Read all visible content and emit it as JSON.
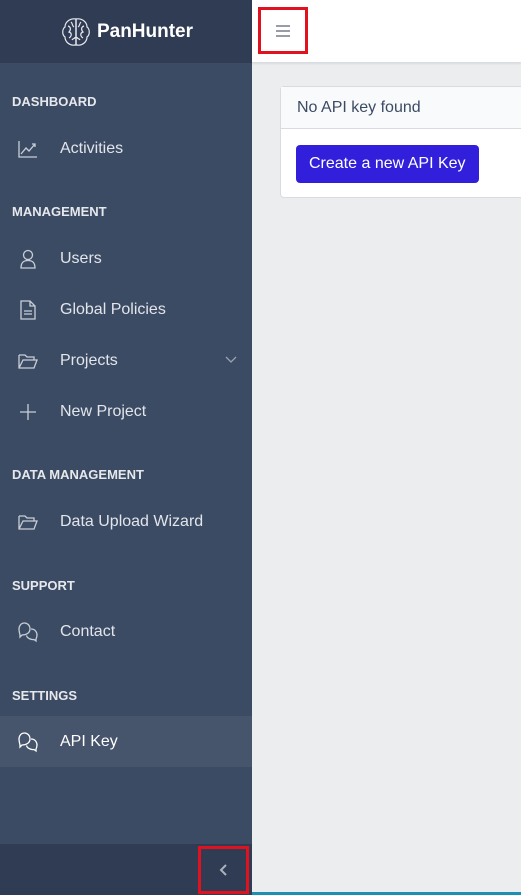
{
  "brand": {
    "name": "PanHunter",
    "logo_icon": "brain-icon"
  },
  "sidebar": {
    "sections": [
      {
        "title": "DASHBOARD"
      },
      {
        "title": "MANAGEMENT"
      },
      {
        "title": "DATA MANAGEMENT"
      },
      {
        "title": "SUPPORT"
      },
      {
        "title": "SETTINGS"
      }
    ],
    "items": [
      {
        "label": "Activities",
        "icon": "chart-line-icon"
      },
      {
        "label": "Users",
        "icon": "user-icon"
      },
      {
        "label": "Global Policies",
        "icon": "document-icon"
      },
      {
        "label": "Projects",
        "icon": "folder-open-icon",
        "has_dropdown": true
      },
      {
        "label": "New Project",
        "icon": "plus-icon"
      },
      {
        "label": "Data Upload Wizard",
        "icon": "folder-open-icon"
      },
      {
        "label": "Contact",
        "icon": "chat-bubbles-icon"
      },
      {
        "label": "API Key",
        "icon": "chat-bubbles-icon",
        "active": true
      }
    ]
  },
  "main": {
    "card": {
      "header": "No API key found",
      "button_label": "Create a new API Key"
    }
  },
  "colors": {
    "sidebar_bg": "#3c4b64",
    "brand_bg": "#303c54",
    "primary": "#321fdb",
    "highlight_border": "#e0121f"
  }
}
